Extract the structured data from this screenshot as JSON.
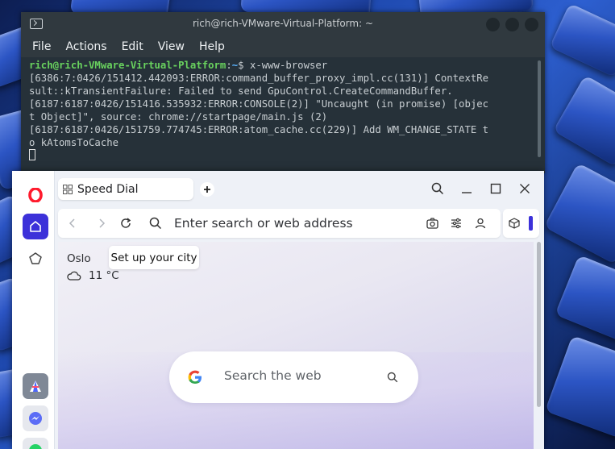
{
  "terminal": {
    "title": "rich@rich-VMware-Virtual-Platform: ~",
    "menu": [
      "File",
      "Actions",
      "Edit",
      "View",
      "Help"
    ],
    "prompt_user": "rich@rich-VMware-Virtual-Platform",
    "prompt_sep": ":",
    "prompt_path": "~",
    "prompt_end": "$ ",
    "command": "x-www-browser",
    "output": [
      "[6386:7:0426/151412.442093:ERROR:command_buffer_proxy_impl.cc(131)] ContextRe",
      "sult::kTransientFailure: Failed to send GpuControl.CreateCommandBuffer.",
      "[6187:6187:0426/151416.535932:ERROR:CONSOLE(2)] \"Uncaught (in promise) [objec",
      "t Object]\", source: chrome://startpage/main.js (2)",
      "[6187:6187:0426/151759.774745:ERROR:atom_cache.cc(229)] Add WM_CHANGE_STATE t",
      "o kAtomsToCache"
    ]
  },
  "browser": {
    "tab_label": "Speed Dial",
    "address_placeholder": "Enter search or web address",
    "weather": {
      "city": "Oslo",
      "tooltip": "Set up your city",
      "temperature": "11 °C"
    },
    "search_placeholder": "Search the web",
    "colors": {
      "opera_red": "#ff1b2d",
      "accent": "#3c31d9"
    }
  }
}
